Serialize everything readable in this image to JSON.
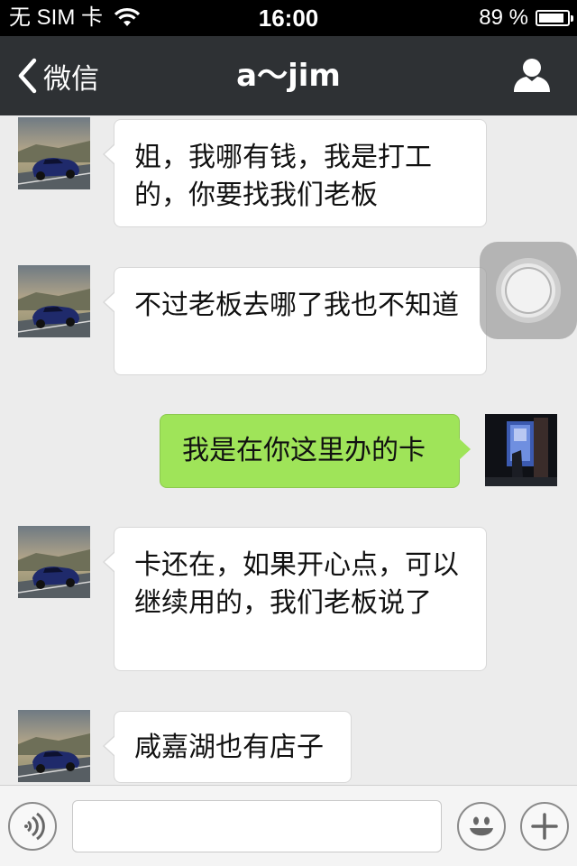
{
  "status_bar": {
    "carrier": "无 SIM 卡",
    "time": "16:00",
    "battery_percent": "89 %",
    "battery_level": 0.89
  },
  "nav": {
    "back_label": "微信",
    "title": "a～jim"
  },
  "messages": [
    {
      "from": "contact",
      "text": "姐，我哪有钱，我是打工的，你要找我们老板"
    },
    {
      "from": "contact",
      "text": "不过老板去哪了我也不知道"
    },
    {
      "from": "me",
      "text": "我是在你这里办的卡"
    },
    {
      "from": "contact",
      "text": "卡还在，如果开心点，可以继续用的，我们老板说了"
    },
    {
      "from": "contact",
      "text": "咸嘉湖也有店子"
    }
  ],
  "input_bar": {
    "placeholder": "",
    "icons": [
      "voice-icon",
      "emoji-icon",
      "plus-icon"
    ]
  },
  "colors": {
    "nav_bg": "#2e3134",
    "chat_bg": "#ececec",
    "outgoing_bubble": "#9fe459",
    "incoming_bubble": "#ffffff"
  }
}
